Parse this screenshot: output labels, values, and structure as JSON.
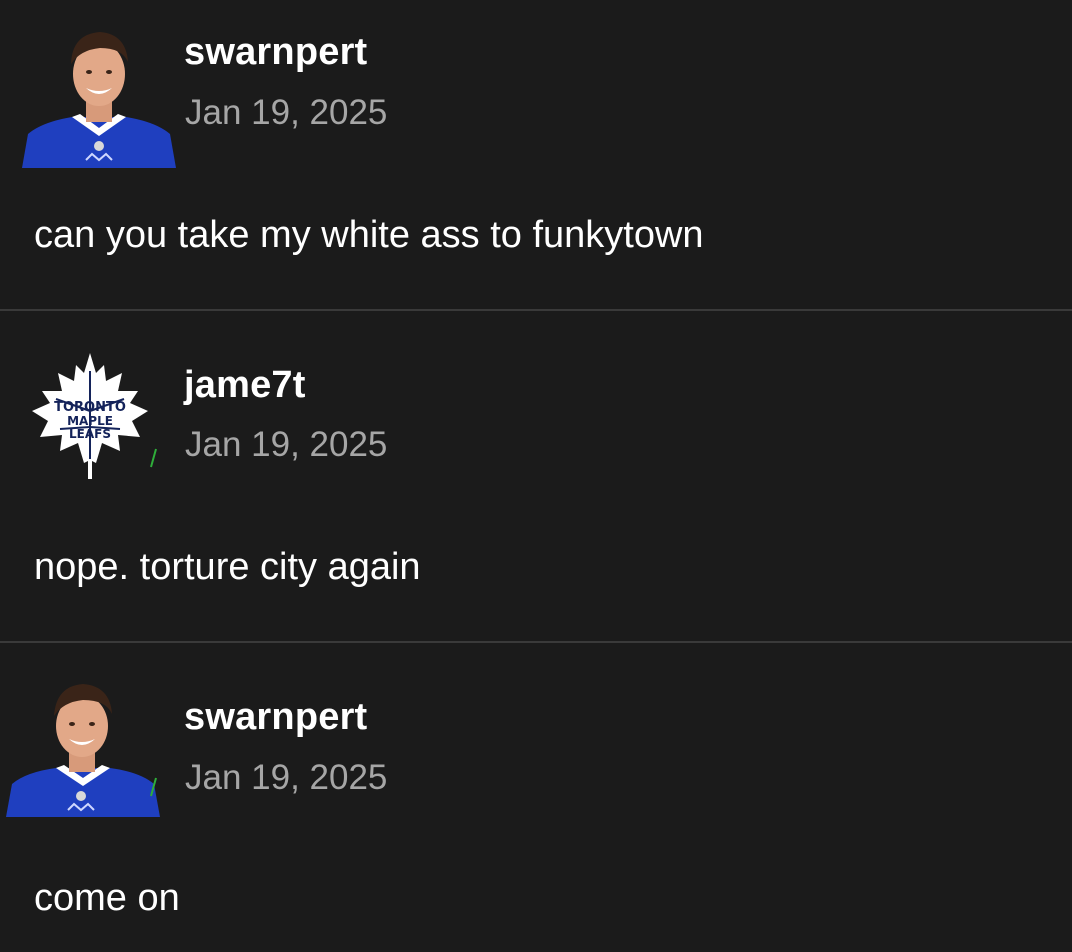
{
  "posts": [
    {
      "username": "swarnpert",
      "date": "Jan 19, 2025",
      "message": "can you take my white ass to funkytown",
      "avatar": "player-headshot"
    },
    {
      "username": "jame7t",
      "date": "Jan 19, 2025",
      "message": "nope. torture city again",
      "avatar": "maple-leafs-logo",
      "avatar_text": [
        "TORONTO",
        "MAPLE",
        "LEAFS"
      ]
    },
    {
      "username": "swarnpert",
      "date": "Jan 19, 2025",
      "message": "come on",
      "avatar": "player-headshot"
    }
  ],
  "colors": {
    "background": "#1b1b1b",
    "divider": "#3a3a3a",
    "username": "#ffffff",
    "date": "#a6a6a6",
    "jersey_blue": "#1f3fbf",
    "leafs_navy": "#14235a"
  }
}
